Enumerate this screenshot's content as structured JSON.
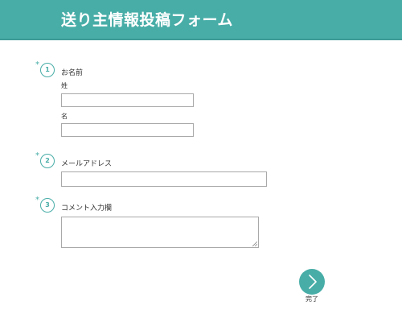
{
  "header": {
    "title": "送り主情報投稿フォーム"
  },
  "questions": [
    {
      "number": "1",
      "required_mark": "*",
      "label": "お名前",
      "fields": [
        {
          "label": "姓",
          "value": ""
        },
        {
          "label": "名",
          "value": ""
        }
      ]
    },
    {
      "number": "2",
      "required_mark": "*",
      "label": "メールアドレス",
      "fields": [
        {
          "value": ""
        }
      ]
    },
    {
      "number": "3",
      "required_mark": "*",
      "label": "コメント入力欄",
      "fields": [
        {
          "value": ""
        }
      ]
    }
  ],
  "submit": {
    "label": "完了",
    "icon": "chevron-right-icon"
  },
  "colors": {
    "accent": "#48ada7",
    "border": "#a9a9a9"
  }
}
